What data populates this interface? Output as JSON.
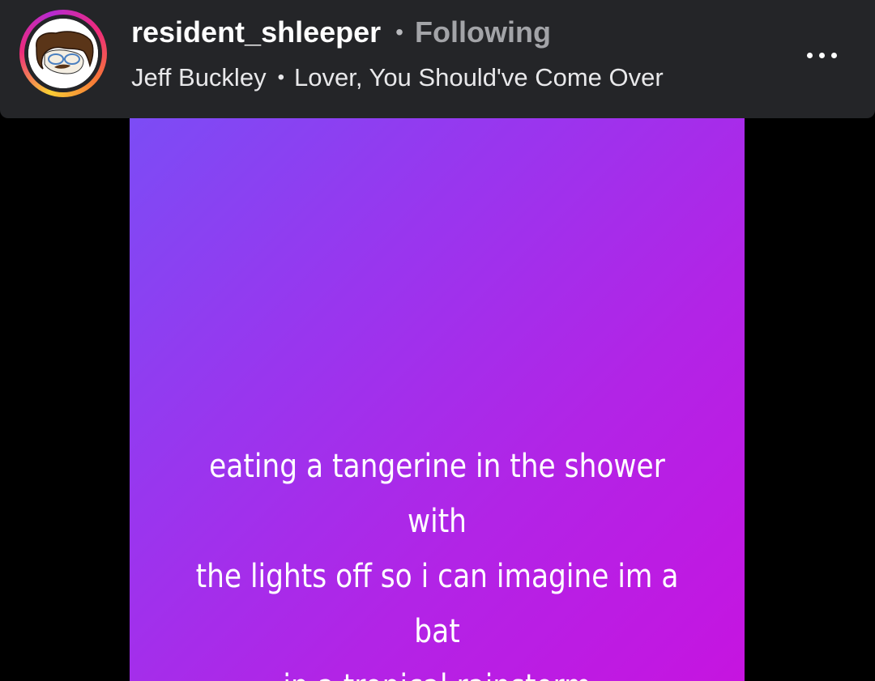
{
  "header": {
    "username": "resident_shleeper",
    "separator": "•",
    "follow_status": "Following",
    "music": {
      "artist": "Jeff Buckley",
      "separator": "•",
      "song": "Lover, You Should've Come Over"
    },
    "more_icon": "more-horizontal-icon"
  },
  "story": {
    "gradient": [
      "#7c4cf5",
      "#c614e0"
    ],
    "text_lines": [
      "eating a tangerine in the shower with",
      "the lights off so i can imagine im a bat",
      "in a tropical rainstorm"
    ]
  },
  "colors": {
    "background": "#000000",
    "header_bg": "#242528",
    "text_primary": "#ffffff",
    "text_secondary": "#a3a4a8"
  }
}
